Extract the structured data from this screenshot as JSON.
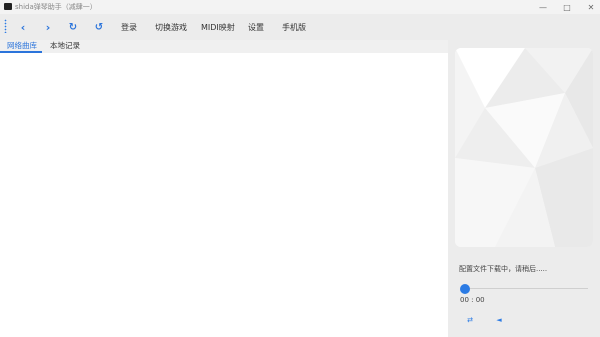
{
  "window": {
    "title": "shida弹琴助手（减肆一）",
    "minimize_icon": "minimize-icon",
    "maximize_icon": "maximize-icon",
    "close_icon": "close-icon"
  },
  "toolbar": {
    "back_icon": "chevron-left-icon",
    "forward_icon": "chevron-right-icon",
    "refresh_icon": "refresh-icon",
    "sync_icon": "sync-icon",
    "menu": [
      "登录",
      "切换游戏",
      "MIDI映射",
      "设置",
      "手机版"
    ]
  },
  "tabs": [
    "网络曲库",
    "本地记录"
  ],
  "active_tab": 0,
  "player": {
    "status": "配置文件下载中，请稍后.....",
    "time": "00 : 00",
    "progress": 0,
    "shuffle_icon": "shuffle-icon",
    "volume_icon": "volume-icon"
  },
  "colors": {
    "accent": "#2b7be4"
  }
}
